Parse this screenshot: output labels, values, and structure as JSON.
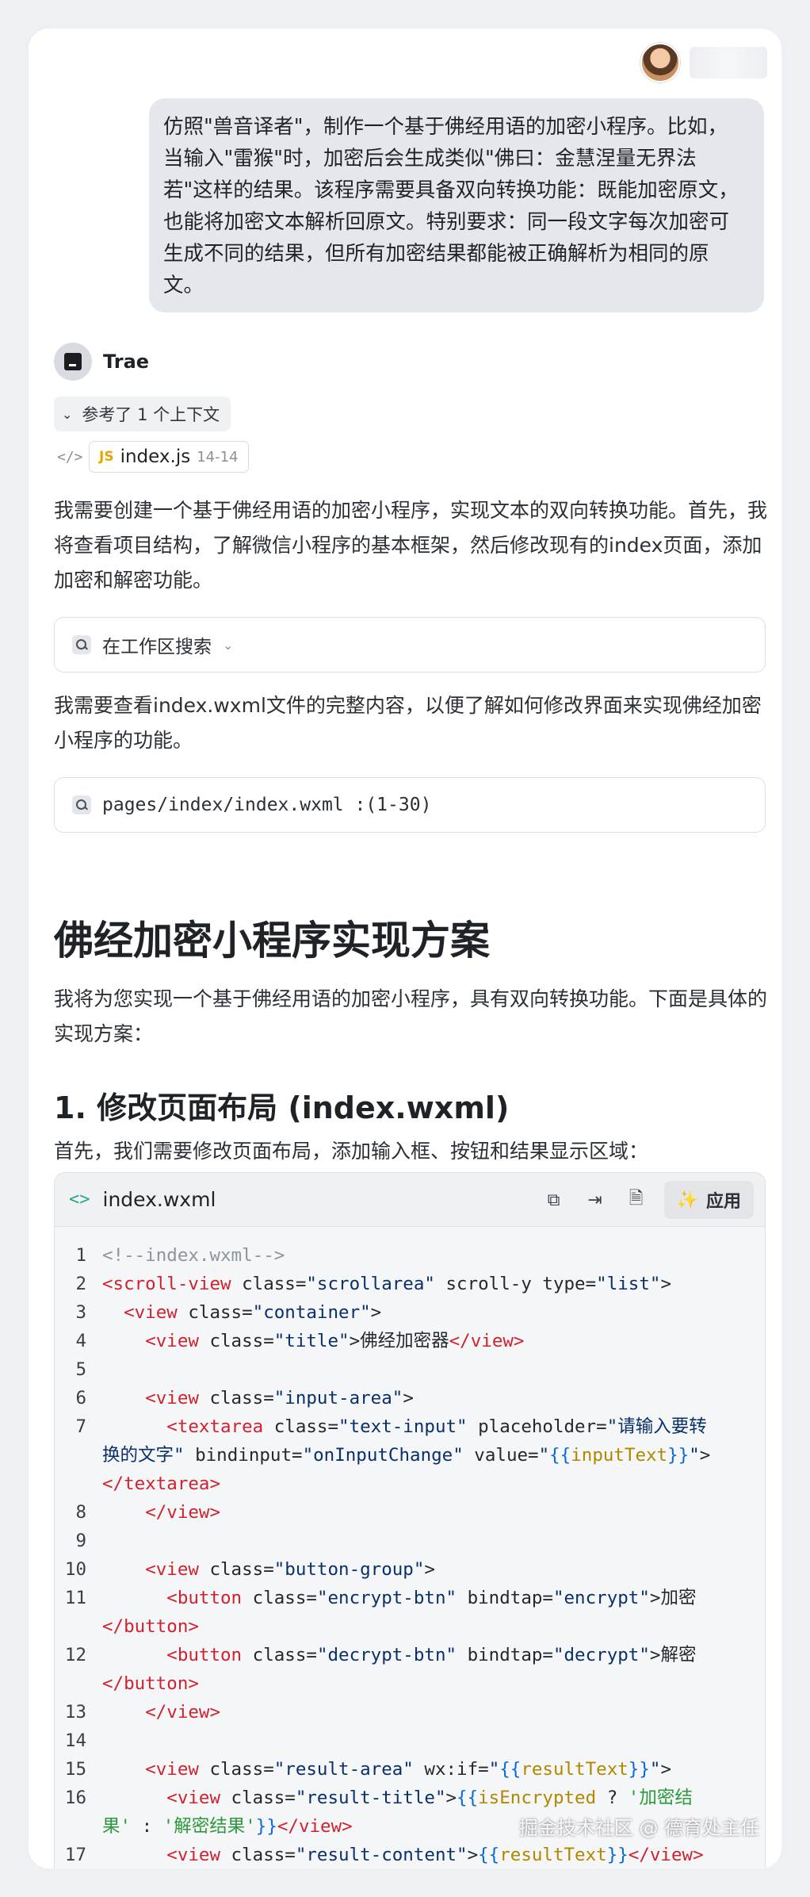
{
  "user": {
    "message": "仿照\"兽音译者\"，制作一个基于佛经用语的加密小程序。比如，当输入\"雷猴\"时，加密后会生成类似\"佛曰：金慧涅量无界法若\"这样的结果。该程序需要具备双向转换功能：既能加密原文，也能将加密文本解析回原文。特别要求：同一段文字每次加密可生成不同的结果，但所有加密结果都能被正确解析为相同的原文。"
  },
  "assistant": {
    "name": "Trae",
    "context_label": "参考了 1 个上下文",
    "context_file": {
      "name": "index.js",
      "badge": "JS",
      "range": "14-14"
    },
    "para1": "我需要创建一个基于佛经用语的加密小程序，实现文本的双向转换功能。首先，我将查看项目结构，了解微信小程序的基本框架，然后修改现有的index页面，添加加密和解密功能。",
    "tool1_label": "在工作区搜索",
    "para2": "我需要查看index.wxml文件的完整内容，以便了解如何修改界面来实现佛经加密小程序的功能。",
    "tool2_label": "pages/index/index.wxml :(1-30)",
    "heading1": "佛经加密小程序实现方案",
    "para3": "我将为您实现一个基于佛经用语的加密小程序，具有双向转换功能。下面是具体的实现方案：",
    "heading2": "1. 修改页面布局 (index.wxml)",
    "para4": "首先，我们需要修改页面布局，添加输入框、按钮和结果显示区域："
  },
  "code_block": {
    "filename": "index.wxml",
    "apply_label": "应用",
    "line_numbers": [
      "1",
      "2",
      "3",
      "4",
      "5",
      "6",
      "7",
      "8",
      "9",
      "10",
      "11",
      "12",
      "13",
      "14",
      "15",
      "16",
      "17"
    ]
  },
  "watermark": "掘金技术社区 @ 德育处主任",
  "icons": [
    "avatar",
    "trae-logo-icon",
    "chevron-down-icon",
    "code-icon",
    "search-icon",
    "copy-icon",
    "insert-icon",
    "new-file-icon",
    "magic-wand-icon"
  ]
}
